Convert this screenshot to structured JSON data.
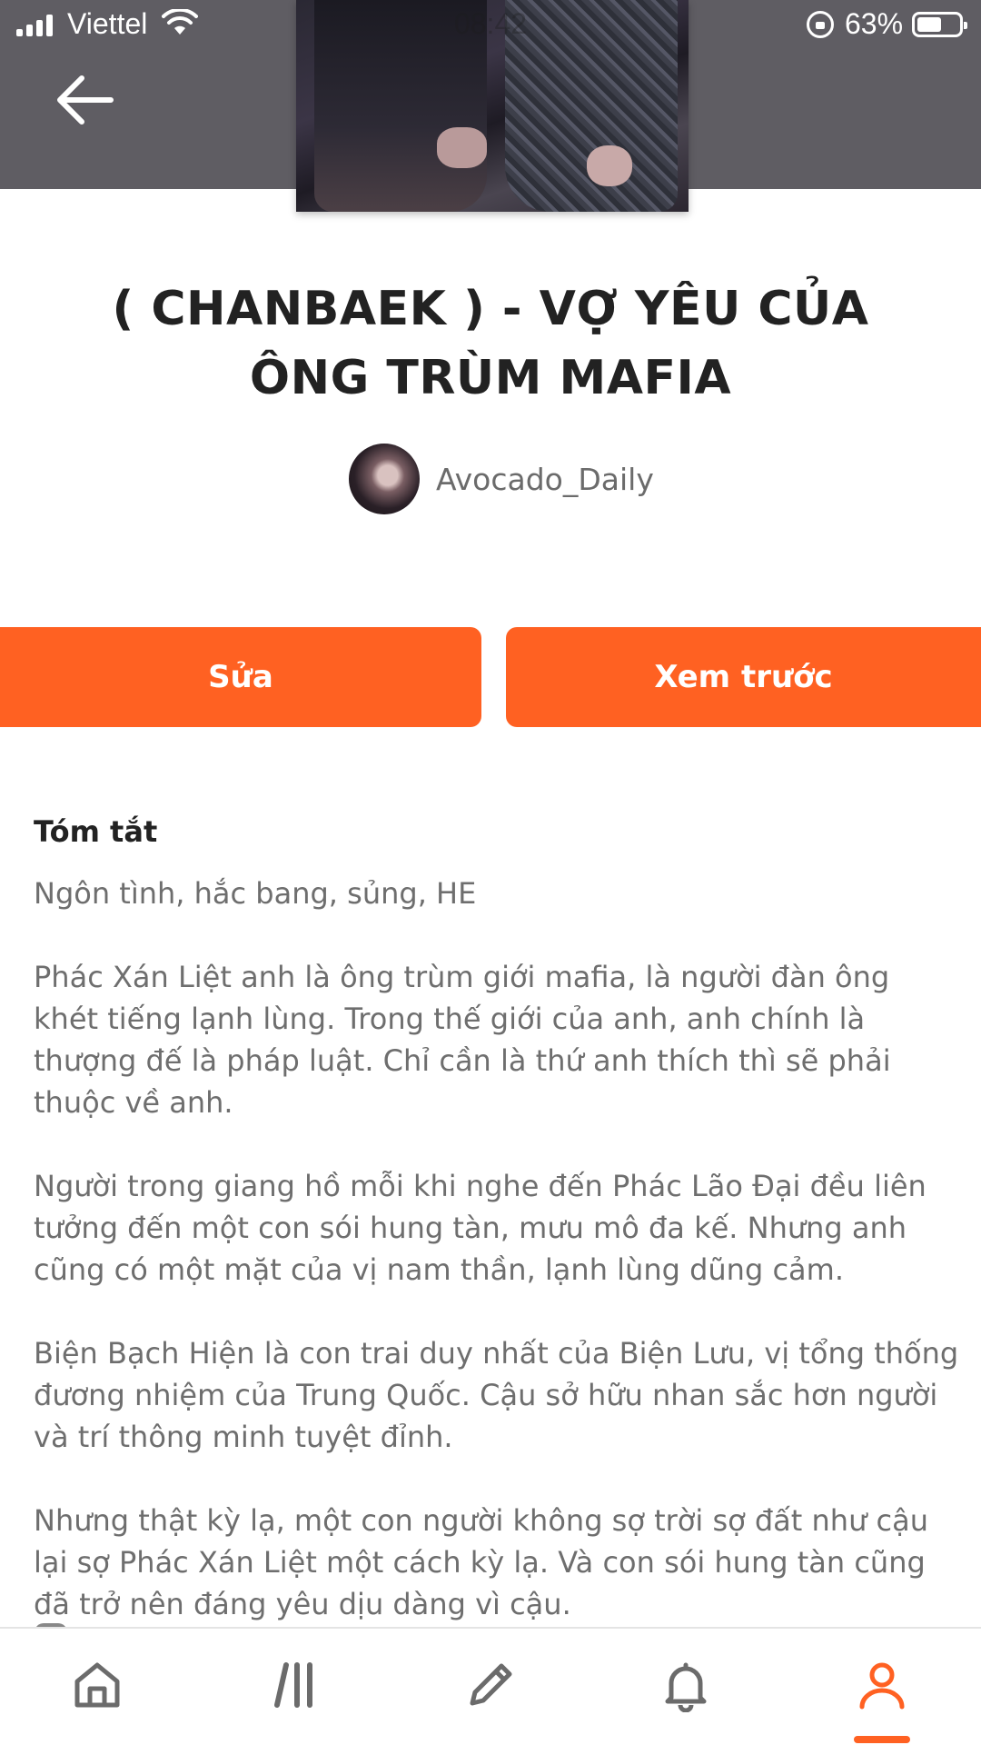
{
  "status_bar": {
    "carrier": "Viettel",
    "time": "08:42",
    "battery_percent": "63%",
    "battery_level": 0.63
  },
  "header": {
    "back_icon": "arrow-left-icon"
  },
  "story": {
    "title": "( CHANBAEK ) - VỢ YÊU CỦA ÔNG TRÙM MAFIA",
    "author": "Avocado_Daily"
  },
  "actions": {
    "edit_label": "Sửa",
    "preview_label": "Xem trước"
  },
  "summary": {
    "heading": "Tóm tắt",
    "paragraphs": [
      "Ngôn tình, hắc bang, sủng, HE",
      "Phác Xán Liệt anh là ông trùm giới mafia, là người đàn ông khét tiếng lạnh lùng. Trong thế giới của anh, anh chính là thượng đế là pháp luật. Chỉ cần là thứ anh thích thì sẽ phải thuộc về anh.",
      "Người trong giang hồ mỗi khi nghe đến Phác Lão Đại đều liên tưởng đến một con sói hung tàn, mưu mô đa kế. Nhưng anh cũng có một mặt của vị nam thần, lạnh lùng dũng cảm.",
      "Biện Bạch Hiện là con trai duy nhất của Biện Lưu, vị tổng thống đương nhiệm của Trung Quốc. Cậu sở hữu nhan sắc hơn người và trí thông minh tuyệt đỉnh.",
      "Nhưng thật kỳ lạ, một con người không sợ trời sợ đất như cậu lại sợ Phác Xán Liệt một cách kỳ lạ. Và con sói hung tàn cũng đã trở nên đáng yêu dịu dàng vì cậu."
    ]
  },
  "bottom_nav": {
    "items": [
      "home-icon",
      "library-icon",
      "write-icon",
      "bell-icon",
      "profile-icon"
    ],
    "active": "profile-icon",
    "active_color": "#ff6122"
  },
  "colors": {
    "accent": "#ff6122",
    "header_bg": "#5f5d63"
  }
}
